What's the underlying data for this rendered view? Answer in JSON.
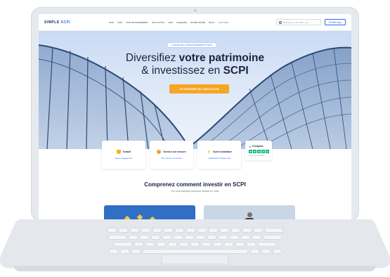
{
  "nav": {
    "logo_prefix": "SIMPLE",
    "logo_accent": "SCPI",
    "items": [
      "SCPI",
      "SCPI",
      "SCPI DE RENDEMENT",
      "NOS OUTILS",
      "SCPI",
      "MAJEURE",
      "NOTRE OFFRE",
      "BLOG",
      "SCPI 2024"
    ],
    "search_placeholder": "Rechercher une SCPI, une...",
    "cta": "Profiter app"
  },
  "hero": {
    "badge": "L'OFFRE DE L'INVESTISSEMENT IN SCPI",
    "title_line1_regular": "Diversifiez ",
    "title_line1_bold": "votre patrimoine",
    "title_line2_regular": "& investissez en ",
    "title_line2_bold": "SCPI",
    "cta": "JE DÉMARRE MA SIMULATION"
  },
  "features": [
    {
      "title": "Gratuit",
      "link": "Sans engagement",
      "icon": "shield-icon",
      "color": "#f5b019"
    },
    {
      "title": "Service sur mesure",
      "link": "Des experts à l'écoute",
      "icon": "person-icon",
      "color": "#f0a23a"
    },
    {
      "title": "Suivi instantané",
      "link": "L'application Simple App",
      "icon": "bolt-icon",
      "color": "#f6c244"
    }
  ],
  "trustpilot": {
    "title": "Trustpilot",
    "stars": [
      "★",
      "★",
      "★",
      "★",
      "★"
    ],
    "sub": "4,8 sur 5 - Excellent"
  },
  "section": {
    "title": "Comprenez comment investir en SCPI",
    "subtitle": "On vous explique comment investir en 2min"
  },
  "colors": {
    "primary": "#2c6cf6",
    "cta": "#f6a623",
    "dark": "#1a2340",
    "trustpilot": "#00b67a"
  }
}
